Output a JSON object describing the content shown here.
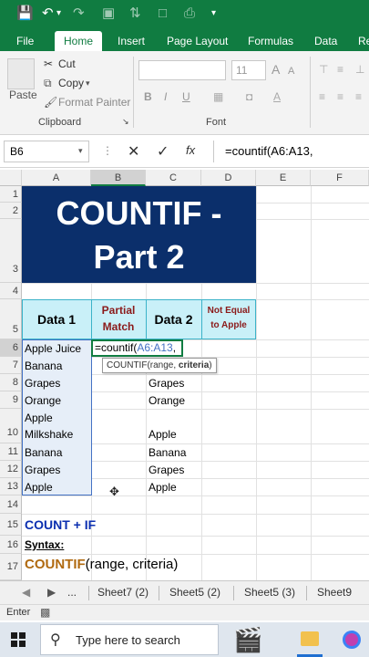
{
  "ribbon_tabs": [
    "File",
    "Home",
    "Insert",
    "Page Layout",
    "Formulas",
    "Data",
    "Re"
  ],
  "clipboard": {
    "paste": "Paste",
    "cut": "Cut",
    "copy": "Copy",
    "format_painter": "Format Painter",
    "group": "Clipboard"
  },
  "font": {
    "size": "11",
    "group": "Font",
    "bold": "B",
    "italic": "I",
    "underline": "U"
  },
  "formula_bar": {
    "name_box": "B6",
    "fx": "fx",
    "formula": "=countif(A6:A13,"
  },
  "columns": [
    "A",
    "B",
    "C",
    "D",
    "E",
    "F"
  ],
  "rows": [
    "1",
    "2",
    "3",
    "4",
    "5",
    "6",
    "7",
    "8",
    "9",
    "10",
    "11",
    "12",
    "13",
    "14",
    "15",
    "16",
    "17"
  ],
  "title_line1": "COUNTIF -",
  "title_line2": "Part 2",
  "headers": {
    "data1": "Data 1",
    "partial1": "Partial",
    "partial2": "Match",
    "data2": "Data 2",
    "noteq1": "Not Equal",
    "noteq2": "to Apple"
  },
  "data1": [
    "Apple Juice",
    "Banana",
    "Grapes",
    "Orange",
    "Apple",
    "Milkshake",
    "Banana",
    "Grapes",
    "Apple"
  ],
  "data2": [
    "Grapes",
    "Orange",
    "Apple",
    "Banana",
    "Grapes",
    "Apple"
  ],
  "editing": {
    "prefix": "=countif(",
    "range": "A6:A13",
    "suffix": ","
  },
  "tooltip": {
    "fn": "COUNTIF(range, ",
    "bold": "criteria",
    "end": ")"
  },
  "notes": {
    "count_if": "COUNT + IF",
    "syntax": "Syntax:",
    "fn": "COUNTIF",
    "args": "(range, criteria)"
  },
  "sheet_tabs": [
    "...",
    "Sheet7 (2)",
    "Sheet5 (2)",
    "Sheet5 (3)",
    "Sheet9"
  ],
  "status": "Enter",
  "taskbar": {
    "search": "Type here to search"
  },
  "colors": {
    "excel_green": "#107c41",
    "title_bg": "#0b2f6b",
    "header_bg": "#c9f0f8",
    "dark_red": "#8b1a1a",
    "blue": "#0b2fb0",
    "brown": "#b06a10"
  }
}
